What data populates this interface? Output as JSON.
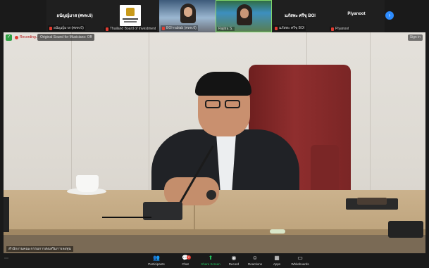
{
  "participants": [
    {
      "display": "อนัญญ์มาส (ศทท.6)",
      "tag": "อนัญญ์มาส (ศทท.6)"
    },
    {
      "display": "",
      "tag": "Thailand Board of Investment"
    },
    {
      "display": "",
      "tag": "BOI-rabiab (ศทท.6)"
    },
    {
      "display": "",
      "tag": "Rajitra S."
    },
    {
      "display": "มภัสพะ ศรีขุ BOI",
      "tag": "มภัสพะ ศรีขุ BOI"
    },
    {
      "display": "Piyanoot",
      "tag": "Piyanoot"
    }
  ],
  "main": {
    "recording_label": "Recording...",
    "interpreter_chip": "Original Sound for Musicians: Off",
    "sign_in": "Sign in",
    "caption": "สำนักงานคณะกรรมการส่งเสริมการลงทุน"
  },
  "toolbar": {
    "items": [
      {
        "label": "Participants",
        "icon": "participants-icon"
      },
      {
        "label": "Chat",
        "icon": "chat-icon",
        "badge": "2"
      },
      {
        "label": "Share Screen",
        "icon": "share-screen-icon"
      },
      {
        "label": "Record",
        "icon": "record-icon"
      },
      {
        "label": "Reactions",
        "icon": "reactions-icon"
      },
      {
        "label": "Apps",
        "icon": "apps-icon"
      },
      {
        "label": "Whiteboards",
        "icon": "whiteboards-icon"
      }
    ]
  },
  "colors": {
    "share_green": "#22c55e",
    "record_red": "#e03c31",
    "active_speaker": "#7fd66b",
    "accent_blue": "#2d8cff"
  }
}
